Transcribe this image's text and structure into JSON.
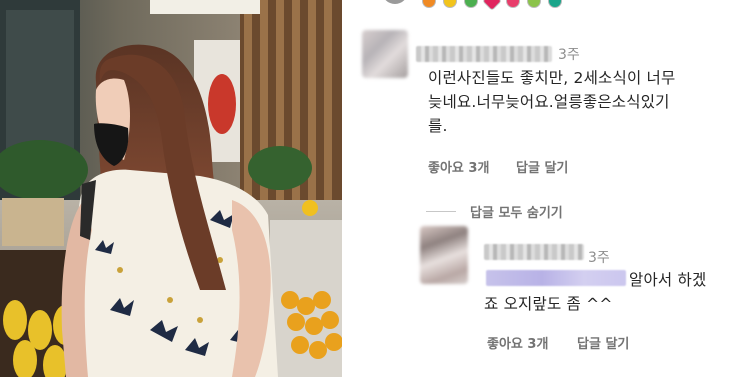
{
  "post": {
    "photo_alt": ""
  },
  "comments": [
    {
      "time": "3주",
      "text_lines": [
        "이런사진들도 좋치만, 2세소식이 너무",
        "늦네요.너무늦어요.얼릉좋은소식있기",
        "를."
      ],
      "likes_label": "좋아요 3개",
      "reply_label": "답글 달기"
    }
  ],
  "replies_toggle_label": "답글 모두 숨기기",
  "replies": [
    {
      "time": "3주",
      "text_line_1": "알아서 하겠",
      "text_line_2": "죠 오지랖도 좀 ^^",
      "likes_label": "좋아요 3개",
      "reply_label": "답글 달기"
    }
  ],
  "colors": {
    "text": "#262626",
    "secondary_text": "#737373",
    "timestamp": "#8e8e8e",
    "mention_highlight": "#b8b2e6"
  }
}
